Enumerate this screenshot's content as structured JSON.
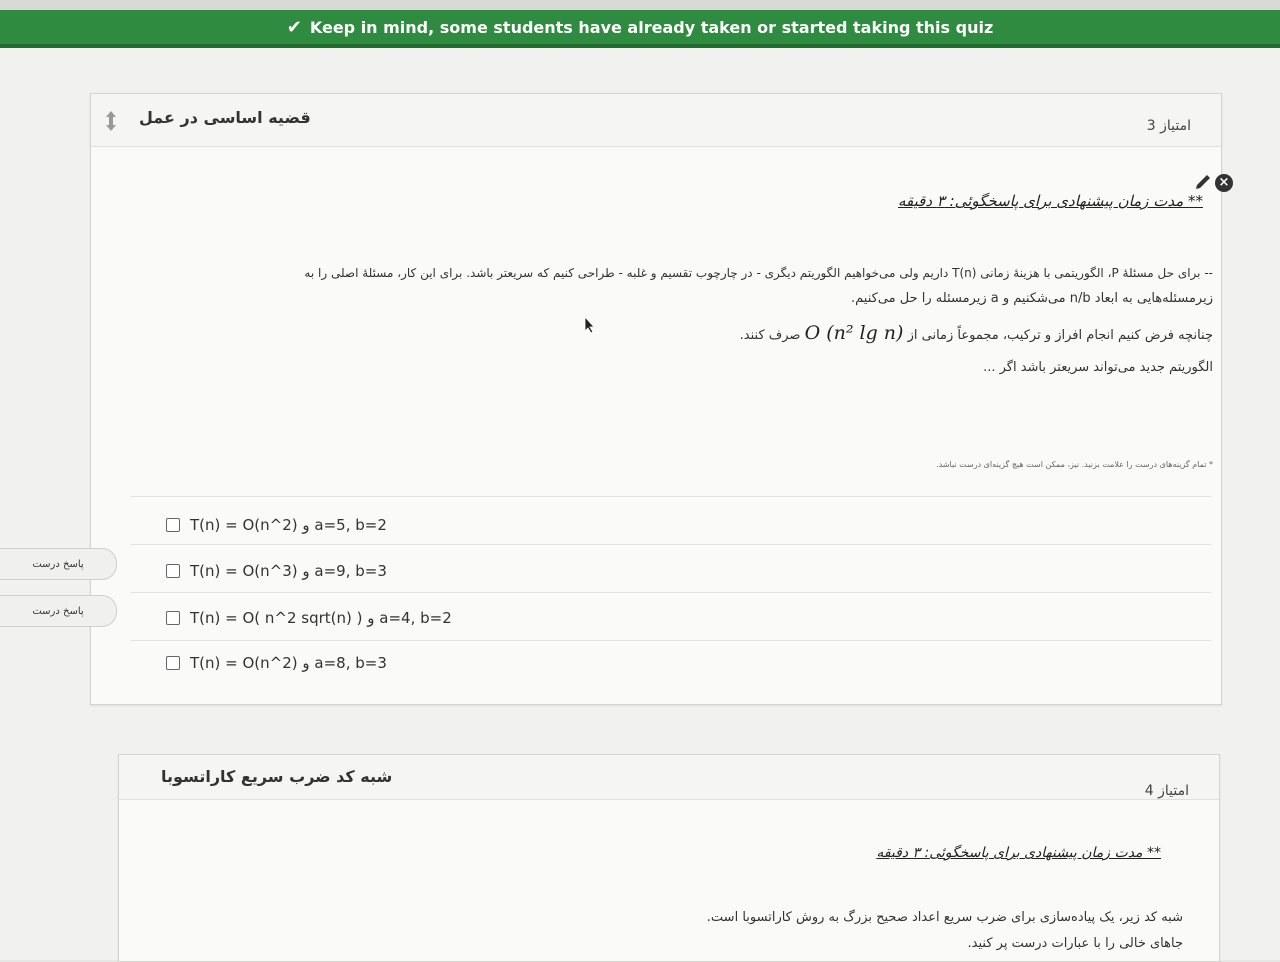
{
  "banner": {
    "text": "Keep in mind, some students have already taken or started taking this quiz"
  },
  "question1": {
    "title": "قضیه اساسی در عمل",
    "points": "امتیاز 3",
    "time_hint": "** مدت زمان پیشنهادی برای پاسخگوئی: ۳ دقیقه",
    "body_line1": "-- برای حل مسئلهٔ P، الگوریتمی با هزینهٔ زمانی T(n) داریم ولی می‌خواهیم الگوریتم دیگری - در چارچوب تقسیم و غلبه - طراحی کنیم که سریعتر باشد. برای این کار، مسئلهٔ اصلی را به",
    "body_line2": "زیرمسئله‌هایی به ابعاد n/b می‌شکنیم و a زیرمسئله را حل می‌کنیم.",
    "body_line3_text": "چنانچه فرض کنیم انجام افراز و ترکیب، مجموعاً زمانی از",
    "body_line3_math": "O (n² lg n)",
    "body_line3_suffix": "صرف کنند.",
    "body_line4": "الگوریتم جدید می‌تواند سریعتر باشد اگر ...",
    "note": "* تمام گزینه‌های درست را علامت بزنید. نیز، ممکن است هیچ گزینه‌ای درست نباشد.",
    "answers": [
      {
        "text": "T(n) = O(n^2) و a=5, b=2"
      },
      {
        "text": "T(n) = O(n^3) و a=9, b=3"
      },
      {
        "text": "T(n) = O( n^2 sqrt(n) ) و a=4, b=2"
      },
      {
        "text": "T(n) = O(n^2) و a=8, b=3"
      }
    ],
    "correct_tag_1": "پاسخ درست",
    "correct_tag_2": "پاسخ درست"
  },
  "question2": {
    "title": "شبه کد ضرب سریع کاراتسوبا",
    "points": "امتیاز 4",
    "time_hint": "** مدت زمان پیشنهادی برای پاسخگوئی: ۳ دقیقه",
    "body_line1": "شبه کد زیر، یک پیاده‌سازی برای ضرب سریع اعداد صحیح بزرگ به روش کاراتسوبا است.",
    "body_line2": "جاهای خالی را با عبارات درست پر کنید."
  },
  "colors": {
    "banner_green": "#2e8b3f",
    "card_bg": "#fafaf8"
  },
  "icons": [
    "check-icon",
    "move-handle-icon",
    "pencil-icon",
    "close-circle-icon",
    "mouse-cursor"
  ]
}
